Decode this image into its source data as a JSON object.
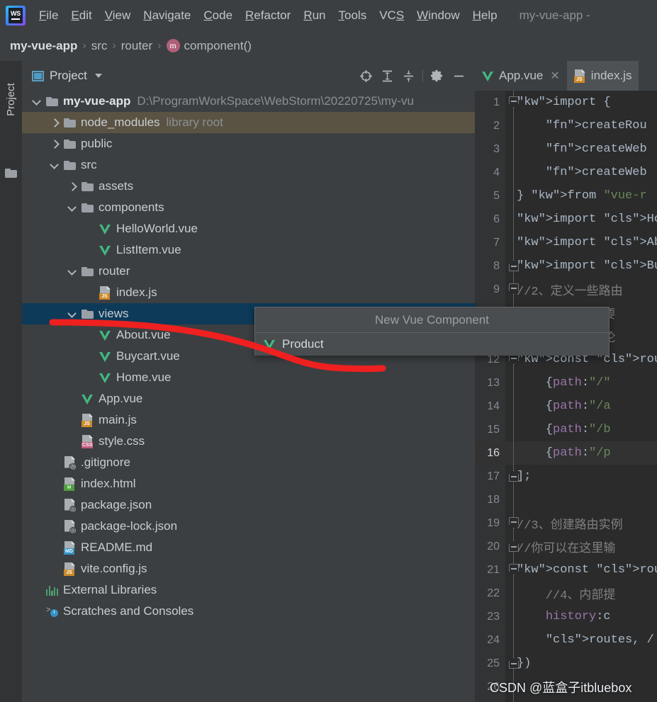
{
  "window": {
    "title_partial": "my-vue-app -",
    "logo_text": "WS"
  },
  "menubar": {
    "items": [
      {
        "label": "File",
        "mnemonic": "F",
        "rest": "ile"
      },
      {
        "label": "Edit",
        "mnemonic": "E",
        "rest": "dit"
      },
      {
        "label": "View",
        "mnemonic": "V",
        "rest": "iew"
      },
      {
        "label": "Navigate",
        "mnemonic": "N",
        "rest": "avigate"
      },
      {
        "label": "Code",
        "mnemonic": "C",
        "rest": "ode"
      },
      {
        "label": "Refactor",
        "mnemonic": "R",
        "rest": "efactor"
      },
      {
        "label": "Run",
        "mnemonic": "R",
        "rest": "un"
      },
      {
        "label": "Tools",
        "mnemonic": "T",
        "rest": "ools"
      },
      {
        "label": "VCS",
        "mnemonic": "S",
        "rest": "",
        "pre": "VC"
      },
      {
        "label": "Window",
        "mnemonic": "W",
        "rest": "indow"
      },
      {
        "label": "Help",
        "mnemonic": "H",
        "rest": "elp"
      }
    ]
  },
  "breadcrumb": {
    "items": [
      "my-vue-app",
      "src",
      "router",
      "component()"
    ],
    "separator": "›",
    "method_icon_letter": "m"
  },
  "toolstrip": {
    "project_tab_label": "Project"
  },
  "project_panel": {
    "title": "Project",
    "tools": [
      {
        "name": "locate-icon",
        "tip": "Select Opened File"
      },
      {
        "name": "expand-all-icon",
        "tip": "Expand All"
      },
      {
        "name": "collapse-all-icon",
        "tip": "Collapse All"
      },
      {
        "name": "settings-gear-icon",
        "tip": "Settings"
      },
      {
        "name": "hide-icon",
        "tip": "Hide"
      }
    ],
    "tree": [
      {
        "label": "my-vue-app",
        "secondary": "D:\\ProgramWorkSpace\\WebStorm\\20220725\\my-vu",
        "depth": 0,
        "icon": "folder",
        "arrow": "down",
        "bold": true,
        "state": "none"
      },
      {
        "label": "node_modules",
        "secondary": "library root",
        "depth": 1,
        "icon": "folder",
        "arrow": "right",
        "bold": false,
        "state": "library"
      },
      {
        "label": "public",
        "secondary": "",
        "depth": 1,
        "icon": "folder",
        "arrow": "right",
        "bold": false,
        "state": "none"
      },
      {
        "label": "src",
        "secondary": "",
        "depth": 1,
        "icon": "folder",
        "arrow": "down",
        "bold": false,
        "state": "none"
      },
      {
        "label": "assets",
        "secondary": "",
        "depth": 2,
        "icon": "folder",
        "arrow": "right",
        "bold": false,
        "state": "none"
      },
      {
        "label": "components",
        "secondary": "",
        "depth": 2,
        "icon": "folder",
        "arrow": "down",
        "bold": false,
        "state": "none"
      },
      {
        "label": "HelloWorld.vue",
        "secondary": "",
        "depth": 3,
        "icon": "vue",
        "arrow": "none",
        "bold": false,
        "state": "none"
      },
      {
        "label": "ListItem.vue",
        "secondary": "",
        "depth": 3,
        "icon": "vue",
        "arrow": "none",
        "bold": false,
        "state": "none"
      },
      {
        "label": "router",
        "secondary": "",
        "depth": 2,
        "icon": "folder",
        "arrow": "down",
        "bold": false,
        "state": "none"
      },
      {
        "label": "index.js",
        "secondary": "",
        "depth": 3,
        "icon": "js",
        "arrow": "none",
        "bold": false,
        "state": "none"
      },
      {
        "label": "views",
        "secondary": "",
        "depth": 2,
        "icon": "folder",
        "arrow": "down",
        "bold": false,
        "state": "selected"
      },
      {
        "label": "About.vue",
        "secondary": "",
        "depth": 3,
        "icon": "vue",
        "arrow": "none",
        "bold": false,
        "state": "none"
      },
      {
        "label": "Buycart.vue",
        "secondary": "",
        "depth": 3,
        "icon": "vue",
        "arrow": "none",
        "bold": false,
        "state": "none"
      },
      {
        "label": "Home.vue",
        "secondary": "",
        "depth": 3,
        "icon": "vue",
        "arrow": "none",
        "bold": false,
        "state": "none"
      },
      {
        "label": "App.vue",
        "secondary": "",
        "depth": 2,
        "icon": "vue",
        "arrow": "none",
        "bold": false,
        "state": "none"
      },
      {
        "label": "main.js",
        "secondary": "",
        "depth": 2,
        "icon": "js",
        "arrow": "none",
        "bold": false,
        "state": "none"
      },
      {
        "label": "style.css",
        "secondary": "",
        "depth": 2,
        "icon": "css",
        "arrow": "none",
        "bold": false,
        "state": "none"
      },
      {
        "label": ".gitignore",
        "secondary": "",
        "depth": 1,
        "icon": "gitignore",
        "arrow": "none",
        "bold": false,
        "state": "none"
      },
      {
        "label": "index.html",
        "secondary": "",
        "depth": 1,
        "icon": "html",
        "arrow": "none",
        "bold": false,
        "state": "none"
      },
      {
        "label": "package.json",
        "secondary": "",
        "depth": 1,
        "icon": "json",
        "arrow": "none",
        "bold": false,
        "state": "none"
      },
      {
        "label": "package-lock.json",
        "secondary": "",
        "depth": 1,
        "icon": "json",
        "arrow": "none",
        "bold": false,
        "state": "none"
      },
      {
        "label": "README.md",
        "secondary": "",
        "depth": 1,
        "icon": "md",
        "arrow": "none",
        "bold": false,
        "state": "none"
      },
      {
        "label": "vite.config.js",
        "secondary": "",
        "depth": 1,
        "icon": "js",
        "arrow": "none",
        "bold": false,
        "state": "none"
      },
      {
        "label": "External Libraries",
        "secondary": "",
        "depth": 0,
        "icon": "extlib",
        "arrow": "none",
        "bold": false,
        "state": "none"
      },
      {
        "label": "Scratches and Consoles",
        "secondary": "",
        "depth": 0,
        "icon": "scratch",
        "arrow": "none",
        "bold": false,
        "state": "none"
      }
    ]
  },
  "popup": {
    "title": "New Vue Component",
    "input_value": "Product",
    "input_icon": "vue-icon"
  },
  "editor": {
    "tabs": [
      {
        "label": "App.vue",
        "icon": "vue-icon",
        "active": false,
        "closable": true,
        "close_glyph": "✕"
      },
      {
        "label": "index.js",
        "icon": "js-icon",
        "active": true,
        "closable": false,
        "close_glyph": ""
      }
    ],
    "current_line": 16,
    "lines": [
      {
        "n": 1,
        "fold": "top",
        "text": "import {"
      },
      {
        "n": 2,
        "fold": "",
        "text": "    createRou"
      },
      {
        "n": 3,
        "fold": "",
        "text": "    createWeb"
      },
      {
        "n": 4,
        "fold": "",
        "text": "    createWeb"
      },
      {
        "n": 5,
        "fold": "",
        "text": "} from \"vue-r"
      },
      {
        "n": 6,
        "fold": "",
        "text": "import Home f"
      },
      {
        "n": 7,
        "fold": "",
        "text": "import About "
      },
      {
        "n": 8,
        "fold": "bot",
        "text": "import Buycar"
      },
      {
        "n": 9,
        "fold": "top",
        "text": "//2、定义一些路由"
      },
      {
        "n": 10,
        "fold": "",
        "text": "//每个路由都需要"
      },
      {
        "n": 11,
        "fold": "",
        "text": "//我们后面再讨论"
      },
      {
        "n": 12,
        "fold": "top",
        "text": "const routes ="
      },
      {
        "n": 13,
        "fold": "",
        "text": "    {path:\"/\""
      },
      {
        "n": 14,
        "fold": "",
        "text": "    {path:\"/a"
      },
      {
        "n": 15,
        "fold": "",
        "text": "    {path:\"/b"
      },
      {
        "n": 16,
        "fold": "",
        "text": "    {path:\"/p"
      },
      {
        "n": 17,
        "fold": "bot",
        "text": "];"
      },
      {
        "n": 18,
        "fold": "",
        "text": ""
      },
      {
        "n": 19,
        "fold": "top",
        "text": "//3、创建路由实例"
      },
      {
        "n": 20,
        "fold": "bot",
        "text": "//你可以在这里输"
      },
      {
        "n": 21,
        "fold": "top",
        "text": "const router ="
      },
      {
        "n": 22,
        "fold": "",
        "text": "    //4、内部提"
      },
      {
        "n": 23,
        "fold": "",
        "text": "    history:c"
      },
      {
        "n": 24,
        "fold": "",
        "text": "    routes, /"
      },
      {
        "n": 25,
        "fold": "bot",
        "text": "})"
      },
      {
        "n": 26,
        "fold": "",
        "text": ""
      }
    ]
  },
  "watermark": {
    "text": "CSDN @蓝盒子itbluebox"
  },
  "annotation": {
    "name": "red-highlight-curve",
    "color": "#ef2020"
  },
  "colors": {
    "bg_panel": "#3c3f41",
    "bg_editor": "#2b2b2b",
    "bg_gutter": "#313335",
    "selection_blue": "#0d3a58",
    "library_olive": "#5a5343",
    "vue_green": "#41b883",
    "accent_blue": "#4e9bc4",
    "annotation_red": "#ef2020"
  }
}
